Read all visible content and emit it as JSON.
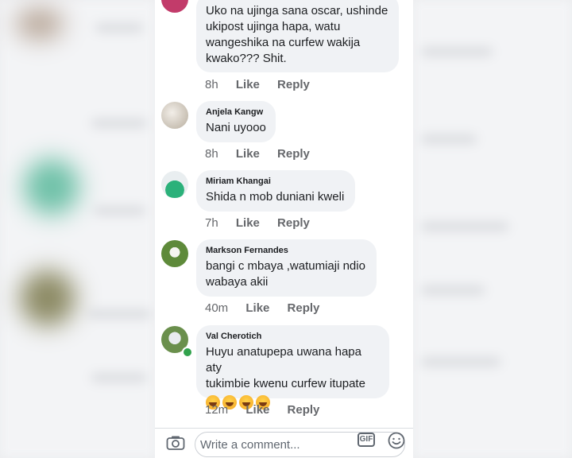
{
  "comments": [
    {
      "name": "",
      "text": "Uko na ujinga sana oscar, ushinde\nukipost ujinga hapa, watu\nwangeshika na curfew wakija\nkwako??? Shit.",
      "time": "8h",
      "like": "Like",
      "reply": "Reply"
    },
    {
      "name": "Anjela Kangw",
      "text": "Nani uyooo",
      "time": "8h",
      "like": "Like",
      "reply": "Reply"
    },
    {
      "name": "Miriam Khangai",
      "text": "Shida n mob duniani kweli",
      "time": "7h",
      "like": "Like",
      "reply": "Reply"
    },
    {
      "name": "Markson Fernandes",
      "text": "bangi c mbaya ,watumiaji ndio\nwabaya akii",
      "time": "40m",
      "like": "Like",
      "reply": "Reply"
    },
    {
      "name": "Val Cherotich",
      "text": "Huyu anatupepa uwana hapa aty\ntukimbie kwenu curfew itupate",
      "emojis": [
        "rofl-emoji",
        "rofl-emoji",
        "rofl-emoji",
        "rofl-emoji"
      ],
      "time": "12m",
      "like": "Like",
      "reply": "Reply"
    }
  ],
  "composer": {
    "placeholder": "Write a comment...",
    "gif_label": "GIF",
    "icons": [
      "camera-icon",
      "gif-icon",
      "smile-icon"
    ]
  },
  "colors": {
    "bubble": "#f0f2f5",
    "action_text": "#65676b",
    "online": "#31a24c"
  }
}
